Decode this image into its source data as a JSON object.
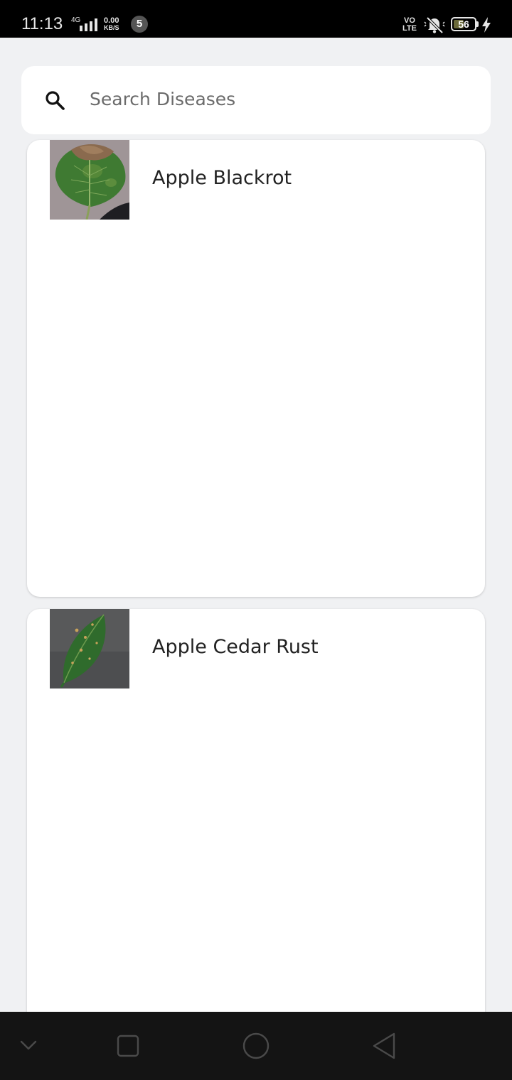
{
  "status_bar": {
    "time": "11:13",
    "network": "4G",
    "speed_value": "0.00",
    "speed_unit": "KB/S",
    "notification_count": "5",
    "volte_top": "VO",
    "volte_bottom": "LTE",
    "battery_level": "56",
    "battery_percent": 56
  },
  "search": {
    "placeholder": "Search Diseases",
    "value": ""
  },
  "diseases": [
    {
      "name": "Apple Blackrot",
      "thumbnail_icon": "leaf-blackrot-image"
    },
    {
      "name": "Apple Cedar Rust",
      "thumbnail_icon": "leaf-cedar-rust-image"
    }
  ],
  "nav_bar": {
    "icons": [
      "chevron-down-icon",
      "recents-square-icon",
      "home-circle-icon",
      "back-triangle-icon"
    ]
  }
}
